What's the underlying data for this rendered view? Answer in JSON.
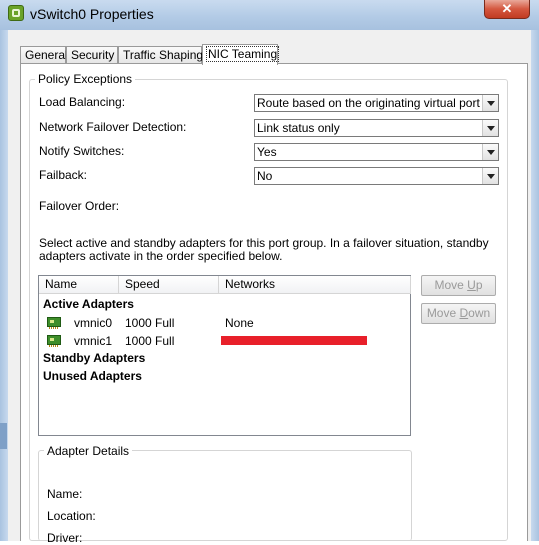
{
  "window": {
    "title": "vSwitch0 Properties",
    "close_glyph": "✕"
  },
  "tabs": [
    {
      "label": "General"
    },
    {
      "label": "Security"
    },
    {
      "label": "Traffic Shaping"
    },
    {
      "label": "NIC Teaming"
    }
  ],
  "policy": {
    "group_title": "Policy Exceptions",
    "load_balancing": {
      "label": "Load Balancing:",
      "value": "Route based on the originating virtual port ID"
    },
    "failover_detection": {
      "label": "Network Failover Detection:",
      "value": "Link status only"
    },
    "notify_switches": {
      "label": "Notify Switches:",
      "value": "Yes"
    },
    "failback": {
      "label": "Failback:",
      "value": "No"
    },
    "failover_order_label": "Failover Order:",
    "instructions_line1": "Select active and standby adapters for this port group.  In a failover situation, standby",
    "instructions_line2": "adapters activate  in the order specified below."
  },
  "adapters": {
    "columns": [
      "Name",
      "Speed",
      "Networks"
    ],
    "active_label": "Active Adapters",
    "standby_label": "Standby Adapters",
    "unused_label": "Unused Adapters",
    "active": [
      {
        "name": "vmnic0",
        "speed": "1000 Full",
        "networks": "None"
      },
      {
        "name": "vmnic1",
        "speed": "1000 Full",
        "networks": ""
      }
    ]
  },
  "buttons": {
    "move_up": "Move Up",
    "move_down": "Move Down"
  },
  "details": {
    "group_title": "Adapter Details",
    "name_label": "Name:",
    "location_label": "Location:",
    "driver_label": "Driver:"
  },
  "colors": {
    "close_button": "#c9452d",
    "redaction": "#e8202a"
  }
}
